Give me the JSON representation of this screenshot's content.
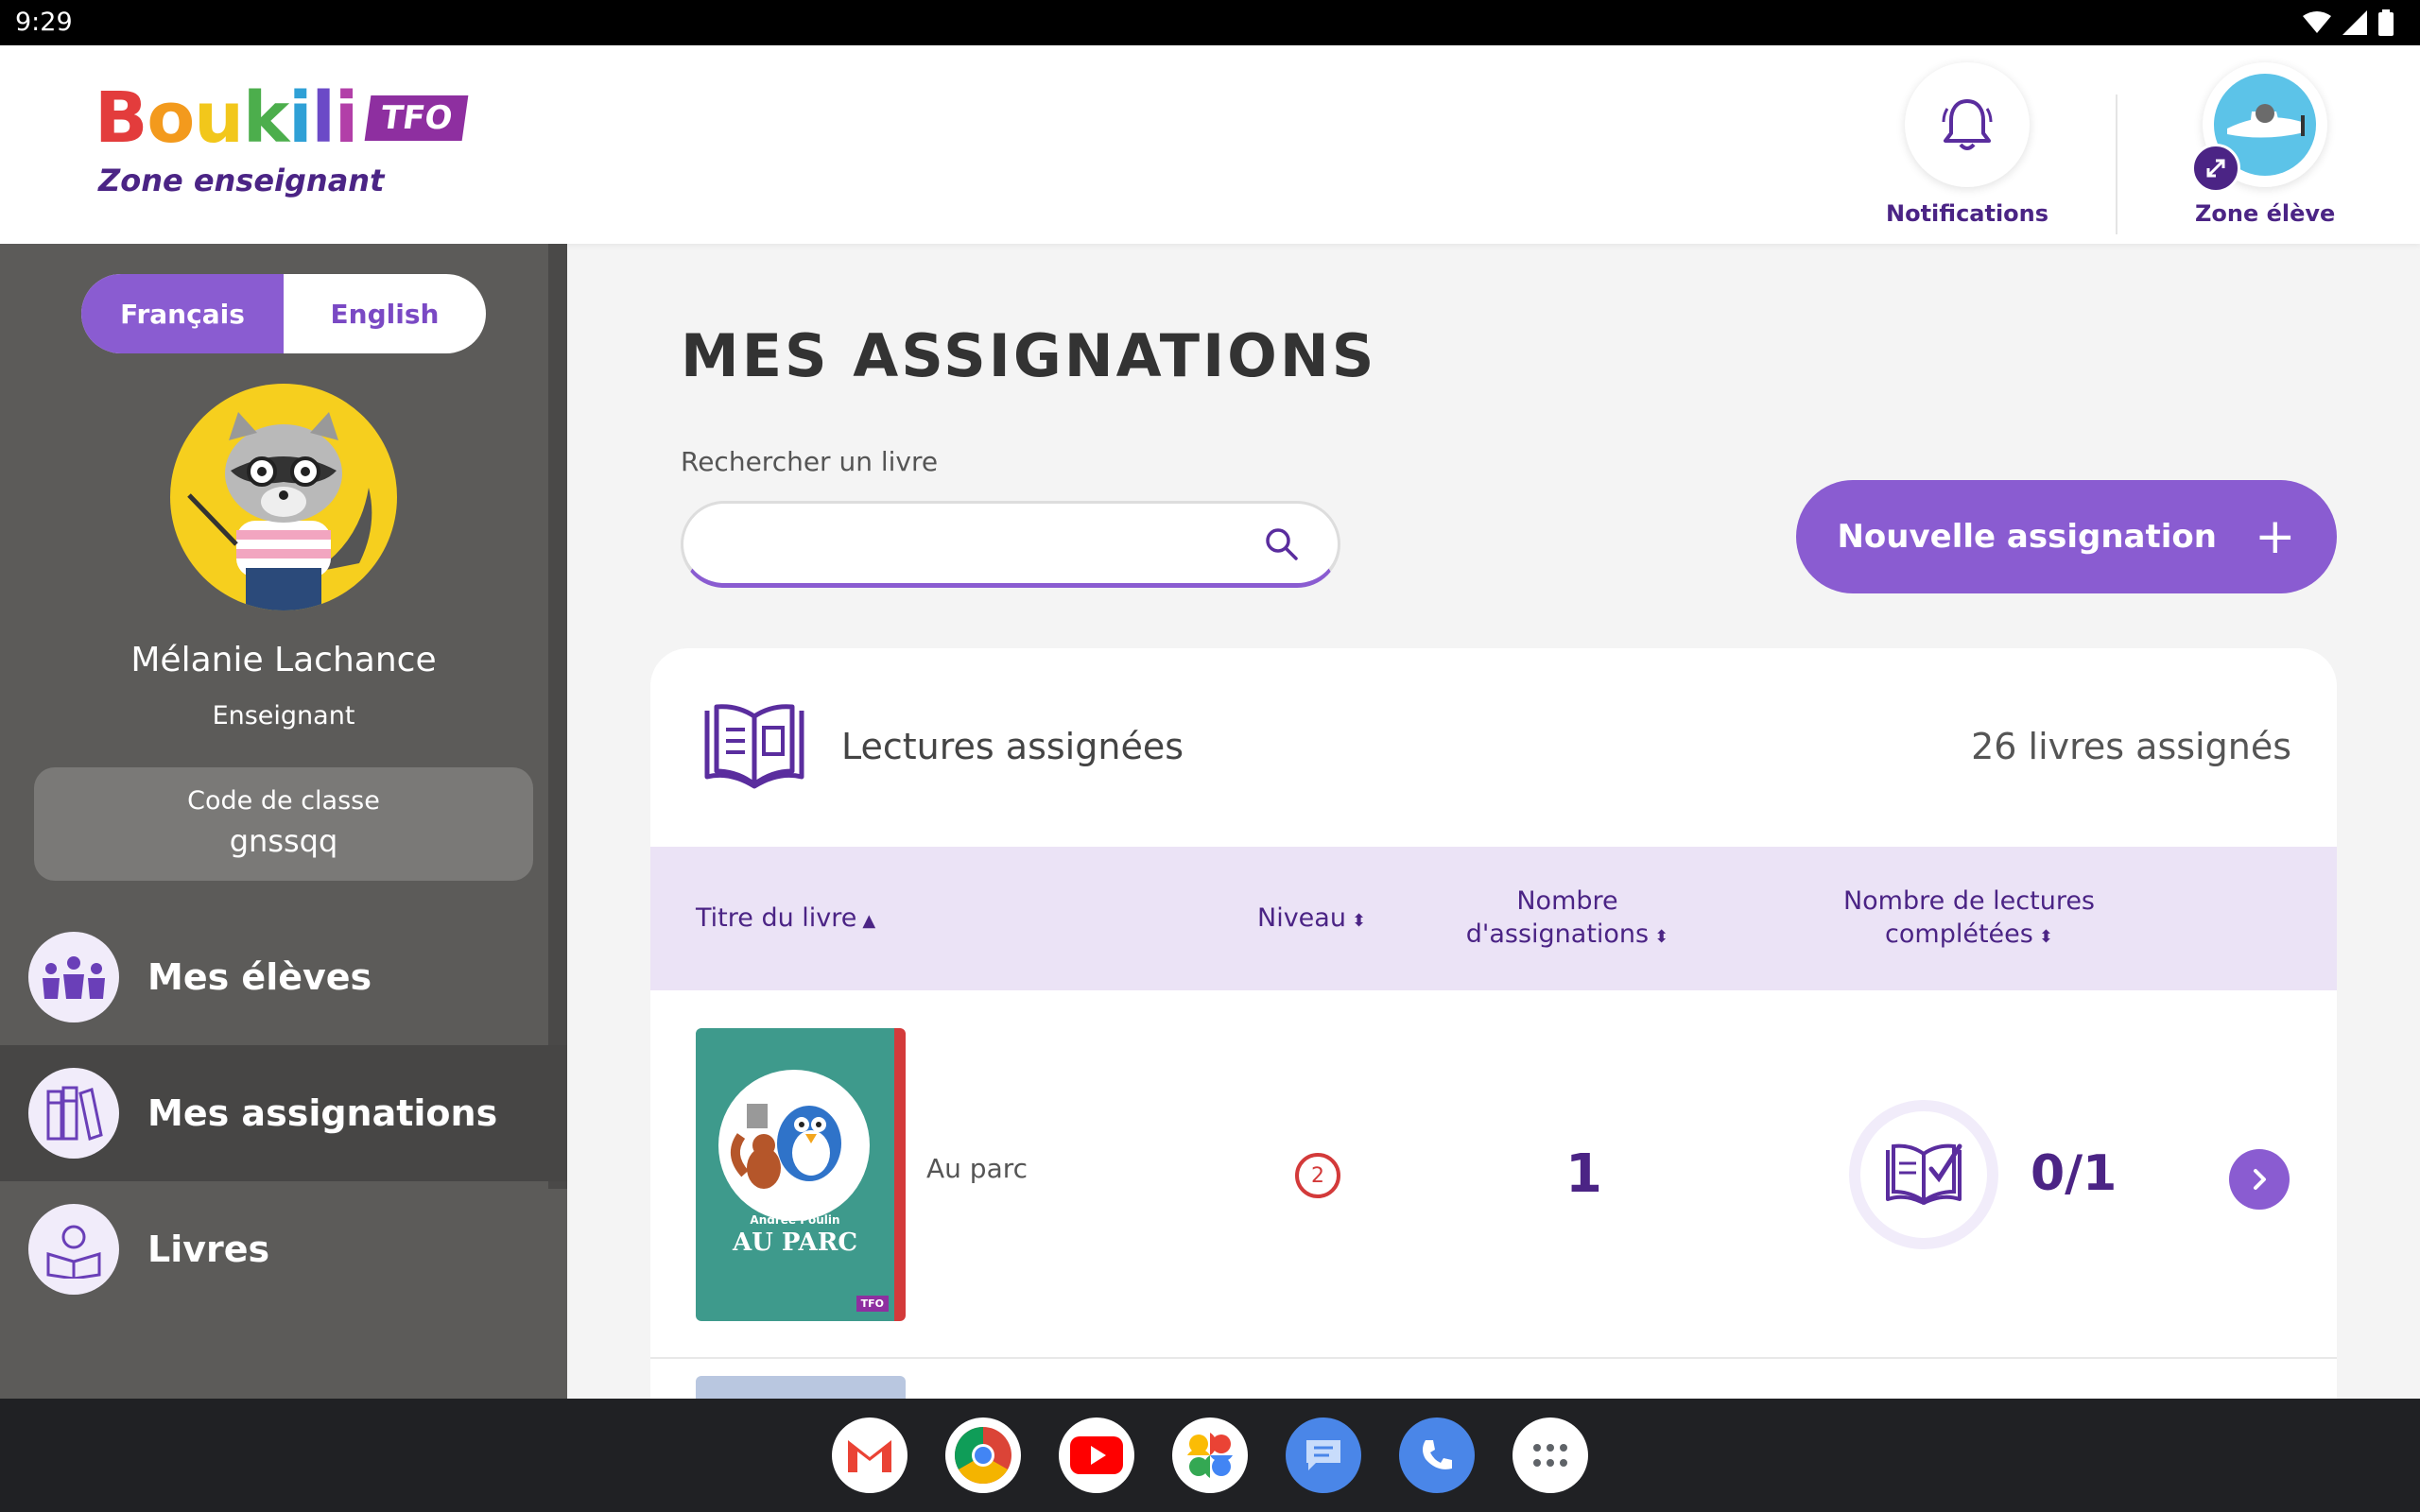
{
  "status_bar": {
    "time": "9:29"
  },
  "header": {
    "logo_text": "Boukili",
    "logo_badge": "TFO",
    "logo_subtitle": "Zone enseignant",
    "notifications_label": "Notifications",
    "student_zone_label": "Zone élève"
  },
  "sidebar": {
    "lang_fr": "Français",
    "lang_en": "English",
    "user_name": "Mélanie Lachance",
    "user_role": "Enseignant",
    "class_code_label": "Code de classe",
    "class_code_value": "gnssqq",
    "nav": [
      {
        "label": "Mes élèves",
        "icon": "students-icon",
        "active": false
      },
      {
        "label": "Mes assignations",
        "icon": "bookshelf-icon",
        "active": true
      },
      {
        "label": "Livres",
        "icon": "reader-icon",
        "active": false
      }
    ]
  },
  "main": {
    "page_title": "MES ASSIGNATIONS",
    "search_label": "Rechercher un livre",
    "search_value": "",
    "new_assignment_label": "Nouvelle assignation",
    "panel": {
      "title": "Lectures assignées",
      "count_text": "26 livres assignés",
      "columns": {
        "title": "Titre du livre",
        "level": "Niveau",
        "assignments_line1": "Nombre",
        "assignments_line2": "d'assignations",
        "completed_line1": "Nombre de lectures",
        "completed_line2": "complétées"
      },
      "rows": [
        {
          "cover_author": "Andrée Poulin",
          "cover_title": "AU PARC",
          "cover_badge": "TFO",
          "title": "Au parc",
          "level": "2",
          "assignments": "1",
          "completed": "0/1"
        }
      ]
    }
  },
  "colors": {
    "accent": "#8a5cd1",
    "deep_purple": "#4b2485",
    "sidebar_bg": "#5c5b59",
    "table_header_bg": "#ebe3f6",
    "level_red": "#d33a3a"
  }
}
